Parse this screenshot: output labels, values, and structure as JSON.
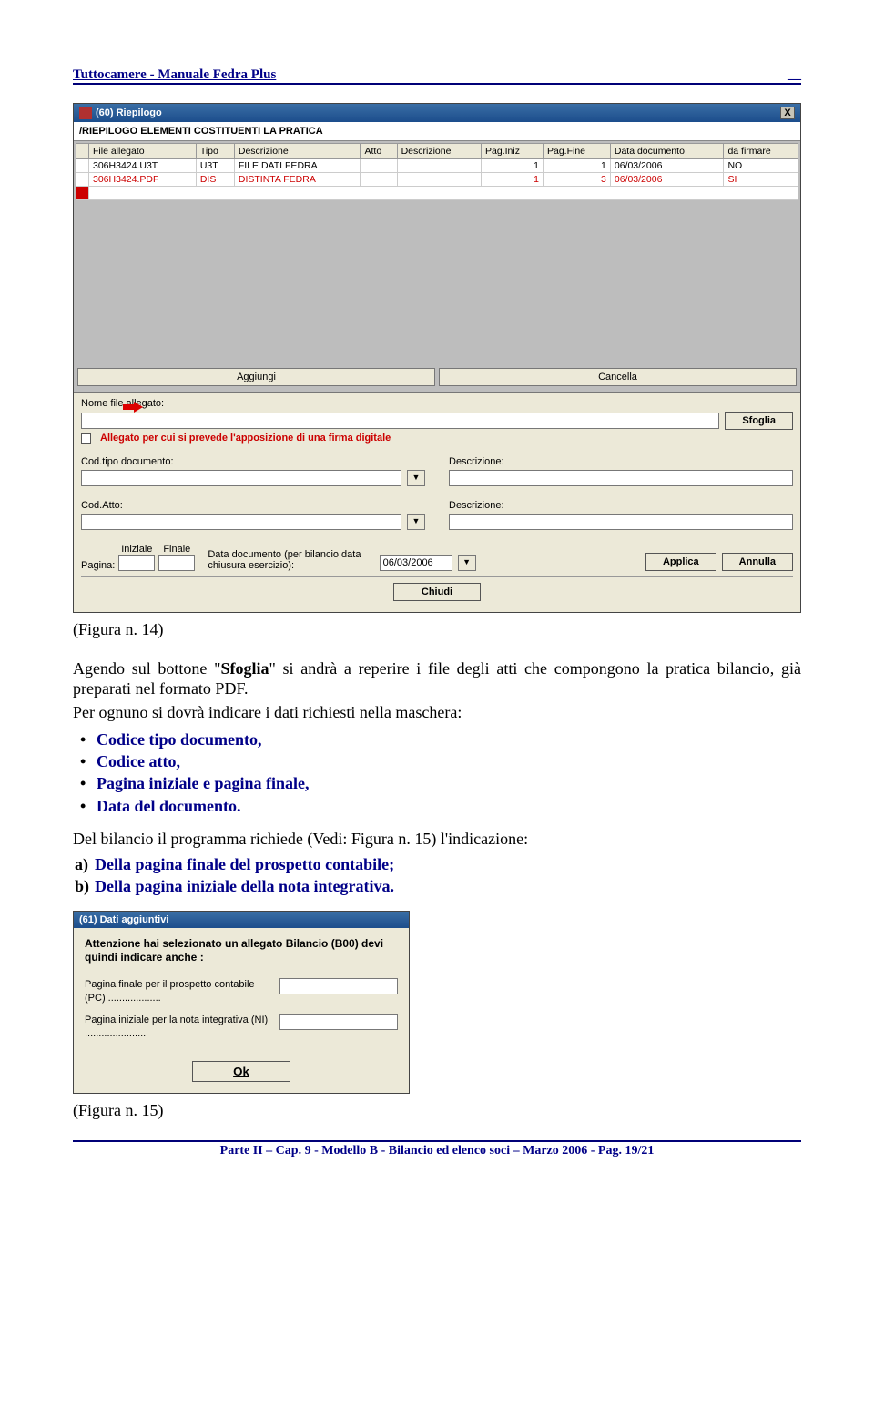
{
  "header": {
    "left": "Tuttocamere - Manuale Fedra Plus",
    "right": "__"
  },
  "screenshot1": {
    "windowTitle": "(60) Riepilogo",
    "subHeader": "/RIEPILOGO ELEMENTI COSTITUENTI LA PRATICA",
    "columns": [
      "",
      "File allegato",
      "Tipo",
      "Descrizione",
      "Atto",
      "Descrizione",
      "Pag.Iniz",
      "Pag.Fine",
      "Data documento",
      "da firmare"
    ],
    "rows": [
      {
        "file": "306H3424.U3T",
        "tipo": "U3T",
        "desc": "FILE DATI FEDRA",
        "atto": "",
        "desc2": "",
        "pi": "1",
        "pf": "1",
        "data": "06/03/2006",
        "firm": "NO"
      },
      {
        "file": "306H3424.PDF",
        "tipo": "DIS",
        "desc": "DISTINTA FEDRA",
        "atto": "",
        "desc2": "",
        "pi": "1",
        "pf": "3",
        "data": "06/03/2006",
        "firm": "SI"
      }
    ],
    "btnAggiungi": "Aggiungi",
    "btnCancella": "Cancella",
    "lblNomeFile": "Nome file allegato:",
    "btnSfoglia": "Sfoglia",
    "chkLabel": "Allegato per cui si prevede l'apposizione di una firma digitale",
    "lblCodTipo": "Cod.tipo documento:",
    "lblDescr": "Descrizione:",
    "lblCodAtto": "Cod.Atto:",
    "lblPagina": "Pagina:",
    "lblIniziale": "Iniziale",
    "lblFinale": "Finale",
    "lblDataDoc": "Data documento (per bilancio data chiusura esercizio):",
    "dateVal": "06/03/2006",
    "btnApplica": "Applica",
    "btnAnnulla": "Annulla",
    "btnChiudi": "Chiudi"
  },
  "caption1": "(Figura n. 14)",
  "para1a": "Agendo sul bottone \"",
  "para1b": "Sfoglia",
  "para1c": "\" si andrà a reperire i file degli atti che compongono la pratica bilancio, già preparati nel formato PDF.",
  "para2": "Per ognuno si dovrà indicare i dati richiesti nella maschera:",
  "bullets": [
    "Codice tipo documento,",
    "Codice atto,",
    "Pagina iniziale e pagina finale,",
    "Data del documento."
  ],
  "para3": "Del bilancio il programma richiede (Vedi: Figura n. 15) l'indicazione:",
  "olist": [
    {
      "m": "a)",
      "t": "Della pagina finale del prospetto contabile;"
    },
    {
      "m": "b)",
      "t": "Della pagina iniziale della nota integrativa."
    }
  ],
  "screenshot2": {
    "title": "(61) Dati aggiuntivi",
    "strong": "Attenzione hai selezionato un allegato Bilancio (B00) devi quindi indicare anche :",
    "f1": "Pagina finale per il prospetto contabile (PC) ...................",
    "f2": "Pagina iniziale per la nota integrativa (NI) ......................",
    "ok": "Ok"
  },
  "caption2": "(Figura n. 15)",
  "footer": "Parte II – Cap. 9 - Modello B - Bilancio ed elenco soci – Marzo 2006 - Pag. 19/21"
}
